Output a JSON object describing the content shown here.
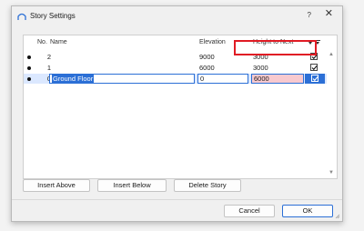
{
  "window": {
    "title": "Story Settings",
    "help_label": "?",
    "close_label": "✕"
  },
  "table": {
    "columns": {
      "no": "No.",
      "name": "Name",
      "elevation": "Elevation",
      "height_to_next": "Height to Next"
    },
    "rows": [
      {
        "no": "2",
        "name": "",
        "elevation": "9000",
        "height_to_next": "3000",
        "checked": true
      },
      {
        "no": "1",
        "name": "",
        "elevation": "6000",
        "height_to_next": "3000",
        "checked": true
      },
      {
        "no": "0",
        "name": "Ground Floor",
        "elevation": "0",
        "height_to_next": "6000",
        "checked": true,
        "selected": true
      }
    ]
  },
  "buttons": {
    "insert_above": "Insert Above",
    "insert_below": "Insert Below",
    "delete_story": "Delete Story",
    "cancel": "Cancel",
    "ok": "OK"
  },
  "colors": {
    "accent": "#2b6fd6",
    "highlight_box": "#e01b24",
    "selected_cell": "#f8c9cf"
  },
  "icons": [
    "app-icon",
    "help-icon",
    "close-icon",
    "show-hide-icon",
    "scroll-up-icon",
    "scroll-down-icon",
    "checkbox-icon"
  ]
}
